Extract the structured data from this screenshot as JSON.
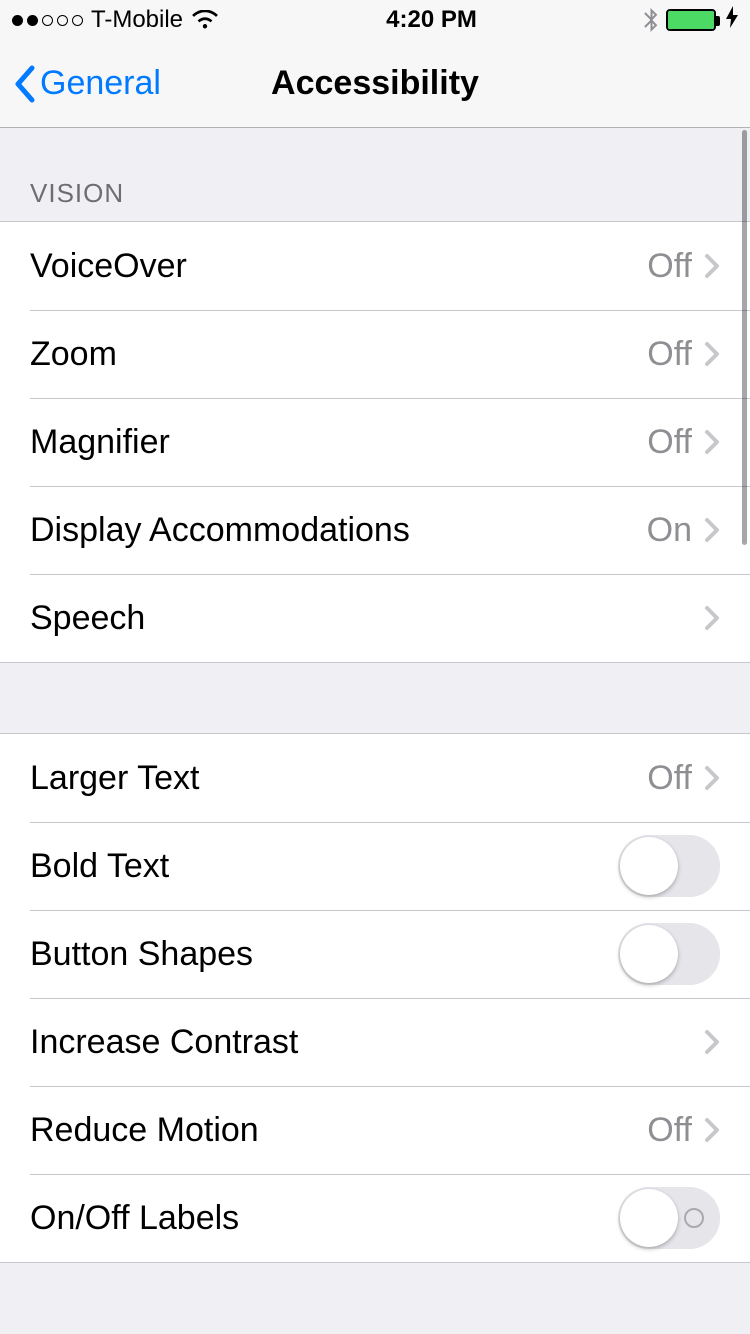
{
  "status": {
    "carrier": "T-Mobile",
    "time": "4:20 PM",
    "signal_filled": 2,
    "signal_total": 5
  },
  "nav": {
    "back_label": "General",
    "title": "Accessibility"
  },
  "sections": {
    "vision_header": "VISION"
  },
  "rows": {
    "voiceover": {
      "label": "VoiceOver",
      "value": "Off"
    },
    "zoom": {
      "label": "Zoom",
      "value": "Off"
    },
    "magnifier": {
      "label": "Magnifier",
      "value": "Off"
    },
    "display_accommodations": {
      "label": "Display Accommodations",
      "value": "On"
    },
    "speech": {
      "label": "Speech"
    },
    "larger_text": {
      "label": "Larger Text",
      "value": "Off"
    },
    "bold_text": {
      "label": "Bold Text"
    },
    "button_shapes": {
      "label": "Button Shapes"
    },
    "increase_contrast": {
      "label": "Increase Contrast"
    },
    "reduce_motion": {
      "label": "Reduce Motion",
      "value": "Off"
    },
    "onoff_labels": {
      "label": "On/Off Labels"
    }
  }
}
